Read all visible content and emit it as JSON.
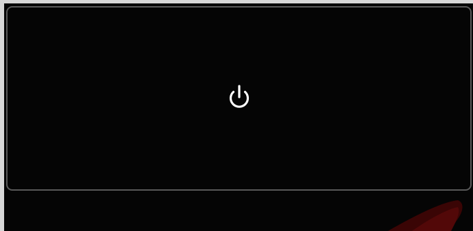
{
  "power_panel": {
    "icon": "power-icon",
    "state": "off"
  },
  "colors": {
    "screen_bg": "#050505",
    "panel_border": "#5a5a5a",
    "icon_color": "#ffffff",
    "frame_bg": "#d8d8d8",
    "accent_swoosh": "#3a0505"
  }
}
